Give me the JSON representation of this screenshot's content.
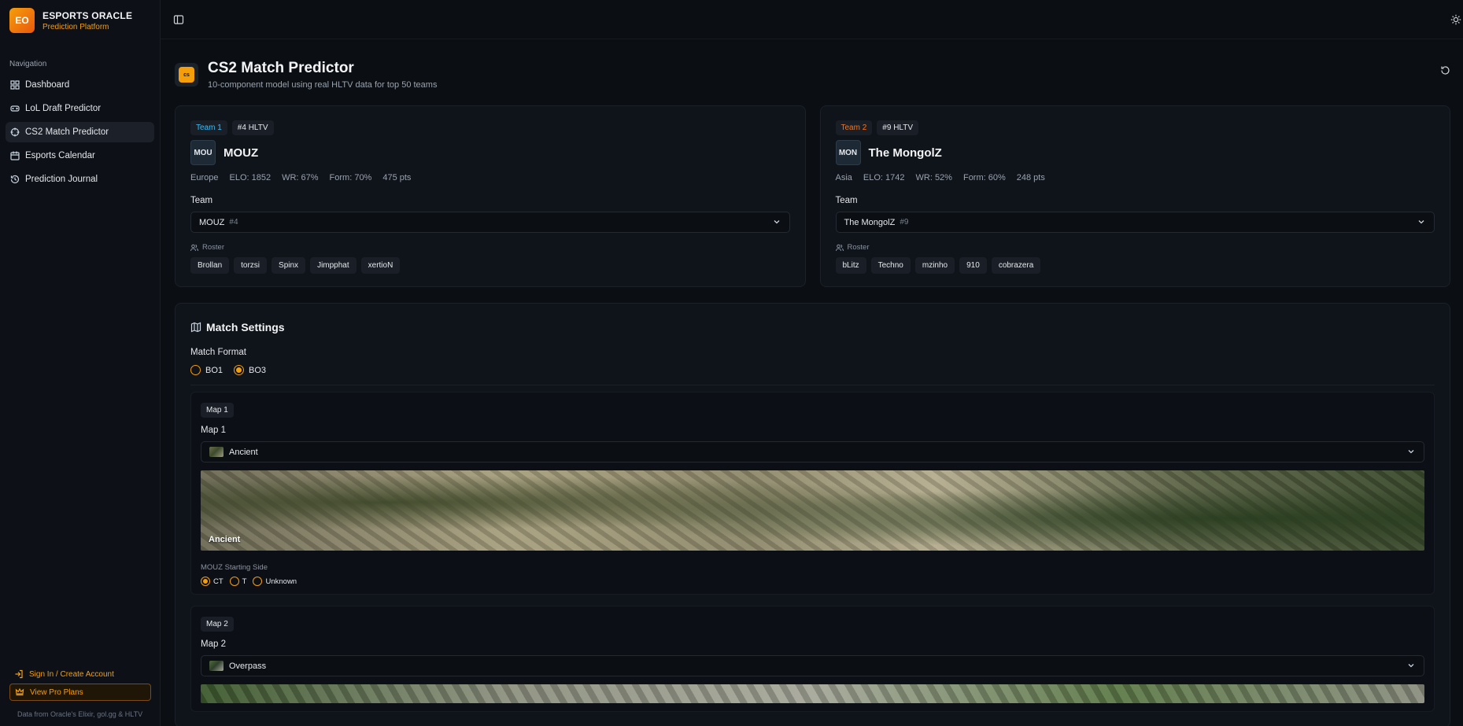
{
  "brand": {
    "logo": "EO",
    "title": "ESPORTS ORACLE",
    "subtitle": "Prediction Platform"
  },
  "nav": {
    "heading": "Navigation",
    "items": [
      {
        "label": "Dashboard",
        "icon": "dashboard-icon"
      },
      {
        "label": "LoL Draft Predictor",
        "icon": "gamepad-icon"
      },
      {
        "label": "CS2 Match Predictor",
        "icon": "crosshair-icon",
        "active": true
      },
      {
        "label": "Esports Calendar",
        "icon": "calendar-icon"
      },
      {
        "label": "Prediction Journal",
        "icon": "history-icon"
      }
    ]
  },
  "footer": {
    "signin": "Sign In / Create Account",
    "pro": "View Pro Plans",
    "data_from": "Data from Oracle's Elixir, gol.gg & HLTV"
  },
  "header": {
    "logo_text": "cs",
    "title": "CS2 Match Predictor",
    "subtitle": "10-component model using real HLTV data for top 50 teams"
  },
  "team1": {
    "badge": "Team 1",
    "rank_badge": "#4 HLTV",
    "abbr": "MOU",
    "name": "MOUZ",
    "region": "Europe",
    "elo": "ELO: 1852",
    "wr": "WR: 67%",
    "form": "Form: 70%",
    "pts": "475 pts",
    "team_label": "Team",
    "select_value": "MOUZ",
    "select_rank": "#4",
    "roster_label": "Roster",
    "roster": [
      "Brollan",
      "torzsi",
      "Spinx",
      "Jimpphat",
      "xertioN"
    ]
  },
  "team2": {
    "badge": "Team 2",
    "rank_badge": "#9 HLTV",
    "abbr": "MON",
    "name": "The MongolZ",
    "region": "Asia",
    "elo": "ELO: 1742",
    "wr": "WR: 52%",
    "form": "Form: 60%",
    "pts": "248 pts",
    "team_label": "Team",
    "select_value": "The MongolZ",
    "select_rank": "#9",
    "roster_label": "Roster",
    "roster": [
      "bLitz",
      "Techno",
      "mzinho",
      "910",
      "cobrazera"
    ]
  },
  "settings": {
    "title": "Match Settings",
    "format_label": "Match Format",
    "formats": [
      "BO1",
      "BO3"
    ],
    "selected_format": "BO3",
    "maps": [
      {
        "badge": "Map 1",
        "label": "Map 1",
        "value": "Ancient",
        "image_label": "Ancient",
        "side_label": "MOUZ Starting Side",
        "sides": [
          "CT",
          "T",
          "Unknown"
        ],
        "selected_side": "CT"
      },
      {
        "badge": "Map 2",
        "label": "Map 2",
        "value": "Overpass"
      }
    ]
  },
  "colors": {
    "accent": "#f59e0b",
    "team1": "#38bdf8",
    "team2": "#f97316",
    "bg": "#0b0e13"
  }
}
